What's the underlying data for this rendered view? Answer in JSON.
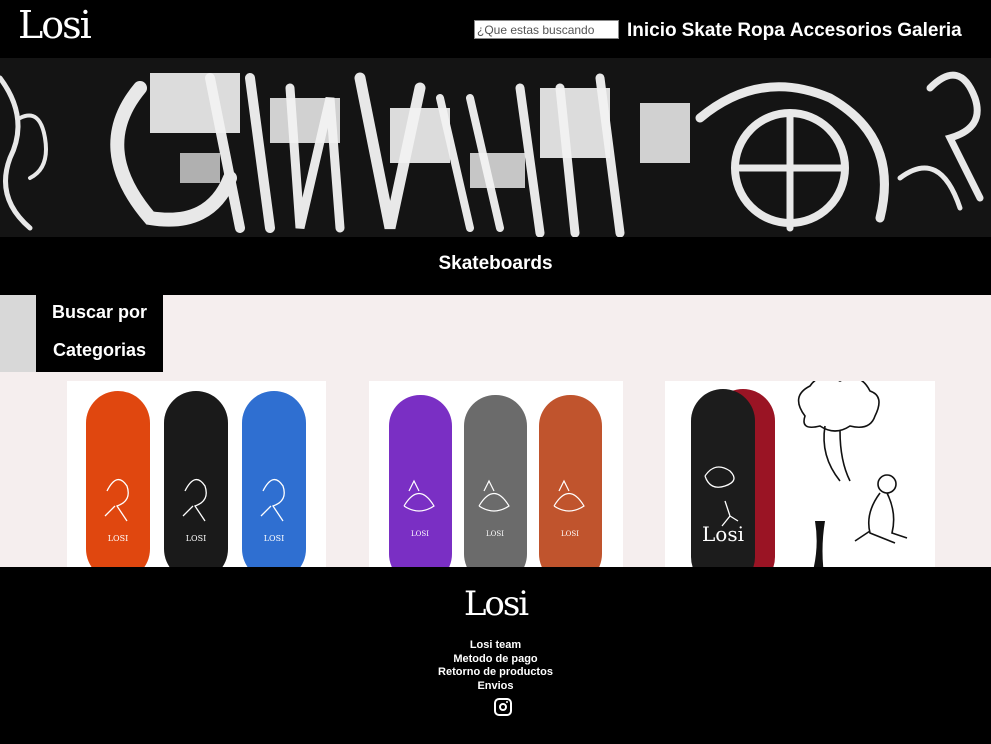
{
  "header": {
    "logo": "Losi",
    "search_placeholder": "¿Que estas buscando",
    "nav": [
      "Inicio",
      "Skate",
      "Ropa",
      "Accesorios",
      "Galeria"
    ]
  },
  "section": {
    "title": "Skateboards"
  },
  "categories": {
    "line1": "Buscar por",
    "line2": "Categorias"
  },
  "products": [
    {
      "deck_colors": [
        "#e0470f",
        "#1a1a1a",
        "#2f6fd1"
      ],
      "deck_brand": "LOSI"
    },
    {
      "deck_colors": [
        "#7a2fc4",
        "#6b6b6b",
        "#c0542d"
      ],
      "deck_brand": "LOSI"
    },
    {
      "deck_colors": [
        "#1c1c1c",
        "#9a1424"
      ],
      "deck_brand": "Losi"
    }
  ],
  "footer": {
    "logo": "Losi",
    "links": [
      "Losi team",
      "Metodo de pago",
      "Retorno de productos",
      "Envios"
    ],
    "social_icon": "instagram-icon"
  }
}
